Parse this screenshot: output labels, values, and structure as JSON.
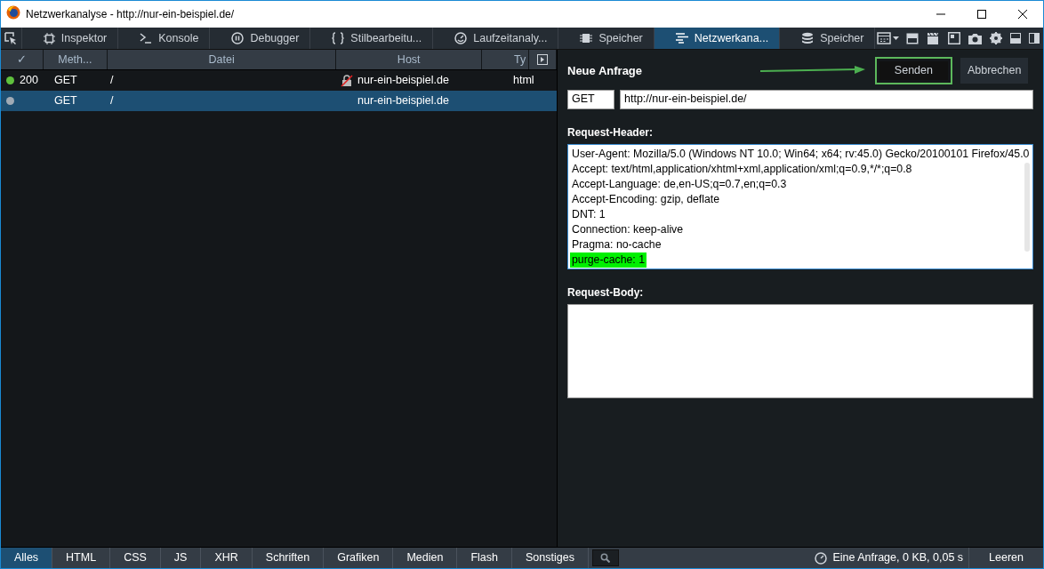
{
  "window": {
    "title": "Netzwerkanalyse - http://nur-ein-beispiel.de/"
  },
  "toolbar_tabs": [
    {
      "label": "Inspektor",
      "selected": false
    },
    {
      "label": "Konsole",
      "selected": false
    },
    {
      "label": "Debugger",
      "selected": false
    },
    {
      "label": "Stilbearbeitu...",
      "selected": false
    },
    {
      "label": "Laufzeitanaly...",
      "selected": false
    },
    {
      "label": "Speicher",
      "selected": false
    },
    {
      "label": "Netzwerkana...",
      "selected": true
    },
    {
      "label": "Speicher",
      "selected": false
    }
  ],
  "table": {
    "columns": [
      "✓",
      "Meth...",
      "Datei",
      "Host",
      "Ty"
    ],
    "rows": [
      {
        "status": "200",
        "color": "#5fc13d",
        "method": "GET",
        "file": "/",
        "host": "nur-ein-beispiel.de",
        "type": "html",
        "insecure": true,
        "selected": false
      },
      {
        "status": "",
        "color": "#a0aab5",
        "method": "GET",
        "file": "/",
        "host": "nur-ein-beispiel.de",
        "type": "",
        "insecure": false,
        "selected": true
      }
    ]
  },
  "request_panel": {
    "title": "Neue Anfrage",
    "buttons": [
      {
        "label": "Senden",
        "highlighted": true
      },
      {
        "label": "Abbrechen",
        "highlighted": false
      }
    ],
    "method": "GET",
    "url": "http://nur-ein-beispiel.de/",
    "headers_label": "Request-Header:",
    "headers": [
      {
        "text": "User-Agent: Mozilla/5.0 (Windows NT 10.0; Win64; x64; rv:45.0) Gecko/20100101 Firefox/45.0",
        "highlighted": false
      },
      {
        "text": "Accept: text/html,application/xhtml+xml,application/xml;q=0.9,*/*;q=0.8",
        "highlighted": false
      },
      {
        "text": "Accept-Language: de,en-US;q=0.7,en;q=0.3",
        "highlighted": false
      },
      {
        "text": "Accept-Encoding: gzip, deflate",
        "highlighted": false
      },
      {
        "text": "DNT: 1",
        "highlighted": false
      },
      {
        "text": "Connection: keep-alive",
        "highlighted": false
      },
      {
        "text": "Pragma: no-cache",
        "highlighted": false
      },
      {
        "text": "purge-cache: 1",
        "highlighted": true
      }
    ],
    "body_label": "Request-Body:"
  },
  "filters": [
    {
      "label": "Alles",
      "selected": true
    },
    {
      "label": "HTML",
      "selected": false
    },
    {
      "label": "CSS",
      "selected": false
    },
    {
      "label": "JS",
      "selected": false
    },
    {
      "label": "XHR",
      "selected": false
    },
    {
      "label": "Schriften",
      "selected": false
    },
    {
      "label": "Grafiken",
      "selected": false
    },
    {
      "label": "Medien",
      "selected": false
    },
    {
      "label": "Flash",
      "selected": false
    },
    {
      "label": "Sonstiges",
      "selected": false
    }
  ],
  "summary": "Eine Anfrage, 0 KB, 0,05 s",
  "clear_button": "Leeren"
}
